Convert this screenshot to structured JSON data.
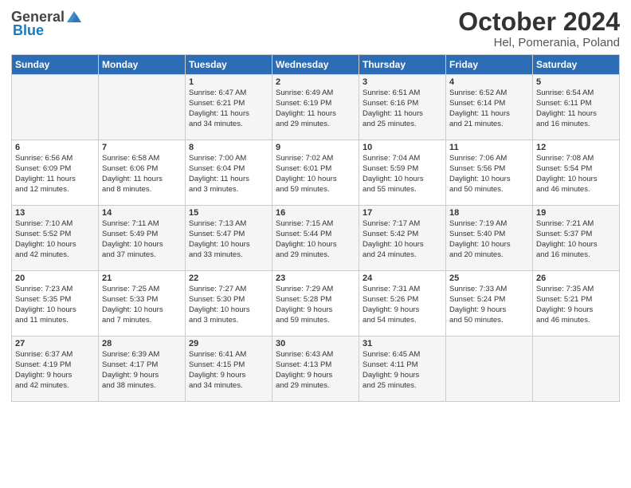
{
  "logo": {
    "general": "General",
    "blue": "Blue"
  },
  "title": "October 2024",
  "location": "Hel, Pomerania, Poland",
  "headers": [
    "Sunday",
    "Monday",
    "Tuesday",
    "Wednesday",
    "Thursday",
    "Friday",
    "Saturday"
  ],
  "rows": [
    [
      {
        "day": "",
        "info": ""
      },
      {
        "day": "",
        "info": ""
      },
      {
        "day": "1",
        "info": "Sunrise: 6:47 AM\nSunset: 6:21 PM\nDaylight: 11 hours\nand 34 minutes."
      },
      {
        "day": "2",
        "info": "Sunrise: 6:49 AM\nSunset: 6:19 PM\nDaylight: 11 hours\nand 29 minutes."
      },
      {
        "day": "3",
        "info": "Sunrise: 6:51 AM\nSunset: 6:16 PM\nDaylight: 11 hours\nand 25 minutes."
      },
      {
        "day": "4",
        "info": "Sunrise: 6:52 AM\nSunset: 6:14 PM\nDaylight: 11 hours\nand 21 minutes."
      },
      {
        "day": "5",
        "info": "Sunrise: 6:54 AM\nSunset: 6:11 PM\nDaylight: 11 hours\nand 16 minutes."
      }
    ],
    [
      {
        "day": "6",
        "info": "Sunrise: 6:56 AM\nSunset: 6:09 PM\nDaylight: 11 hours\nand 12 minutes."
      },
      {
        "day": "7",
        "info": "Sunrise: 6:58 AM\nSunset: 6:06 PM\nDaylight: 11 hours\nand 8 minutes."
      },
      {
        "day": "8",
        "info": "Sunrise: 7:00 AM\nSunset: 6:04 PM\nDaylight: 11 hours\nand 3 minutes."
      },
      {
        "day": "9",
        "info": "Sunrise: 7:02 AM\nSunset: 6:01 PM\nDaylight: 10 hours\nand 59 minutes."
      },
      {
        "day": "10",
        "info": "Sunrise: 7:04 AM\nSunset: 5:59 PM\nDaylight: 10 hours\nand 55 minutes."
      },
      {
        "day": "11",
        "info": "Sunrise: 7:06 AM\nSunset: 5:56 PM\nDaylight: 10 hours\nand 50 minutes."
      },
      {
        "day": "12",
        "info": "Sunrise: 7:08 AM\nSunset: 5:54 PM\nDaylight: 10 hours\nand 46 minutes."
      }
    ],
    [
      {
        "day": "13",
        "info": "Sunrise: 7:10 AM\nSunset: 5:52 PM\nDaylight: 10 hours\nand 42 minutes."
      },
      {
        "day": "14",
        "info": "Sunrise: 7:11 AM\nSunset: 5:49 PM\nDaylight: 10 hours\nand 37 minutes."
      },
      {
        "day": "15",
        "info": "Sunrise: 7:13 AM\nSunset: 5:47 PM\nDaylight: 10 hours\nand 33 minutes."
      },
      {
        "day": "16",
        "info": "Sunrise: 7:15 AM\nSunset: 5:44 PM\nDaylight: 10 hours\nand 29 minutes."
      },
      {
        "day": "17",
        "info": "Sunrise: 7:17 AM\nSunset: 5:42 PM\nDaylight: 10 hours\nand 24 minutes."
      },
      {
        "day": "18",
        "info": "Sunrise: 7:19 AM\nSunset: 5:40 PM\nDaylight: 10 hours\nand 20 minutes."
      },
      {
        "day": "19",
        "info": "Sunrise: 7:21 AM\nSunset: 5:37 PM\nDaylight: 10 hours\nand 16 minutes."
      }
    ],
    [
      {
        "day": "20",
        "info": "Sunrise: 7:23 AM\nSunset: 5:35 PM\nDaylight: 10 hours\nand 11 minutes."
      },
      {
        "day": "21",
        "info": "Sunrise: 7:25 AM\nSunset: 5:33 PM\nDaylight: 10 hours\nand 7 minutes."
      },
      {
        "day": "22",
        "info": "Sunrise: 7:27 AM\nSunset: 5:30 PM\nDaylight: 10 hours\nand 3 minutes."
      },
      {
        "day": "23",
        "info": "Sunrise: 7:29 AM\nSunset: 5:28 PM\nDaylight: 9 hours\nand 59 minutes."
      },
      {
        "day": "24",
        "info": "Sunrise: 7:31 AM\nSunset: 5:26 PM\nDaylight: 9 hours\nand 54 minutes."
      },
      {
        "day": "25",
        "info": "Sunrise: 7:33 AM\nSunset: 5:24 PM\nDaylight: 9 hours\nand 50 minutes."
      },
      {
        "day": "26",
        "info": "Sunrise: 7:35 AM\nSunset: 5:21 PM\nDaylight: 9 hours\nand 46 minutes."
      }
    ],
    [
      {
        "day": "27",
        "info": "Sunrise: 6:37 AM\nSunset: 4:19 PM\nDaylight: 9 hours\nand 42 minutes."
      },
      {
        "day": "28",
        "info": "Sunrise: 6:39 AM\nSunset: 4:17 PM\nDaylight: 9 hours\nand 38 minutes."
      },
      {
        "day": "29",
        "info": "Sunrise: 6:41 AM\nSunset: 4:15 PM\nDaylight: 9 hours\nand 34 minutes."
      },
      {
        "day": "30",
        "info": "Sunrise: 6:43 AM\nSunset: 4:13 PM\nDaylight: 9 hours\nand 29 minutes."
      },
      {
        "day": "31",
        "info": "Sunrise: 6:45 AM\nSunset: 4:11 PM\nDaylight: 9 hours\nand 25 minutes."
      },
      {
        "day": "",
        "info": ""
      },
      {
        "day": "",
        "info": ""
      }
    ]
  ]
}
